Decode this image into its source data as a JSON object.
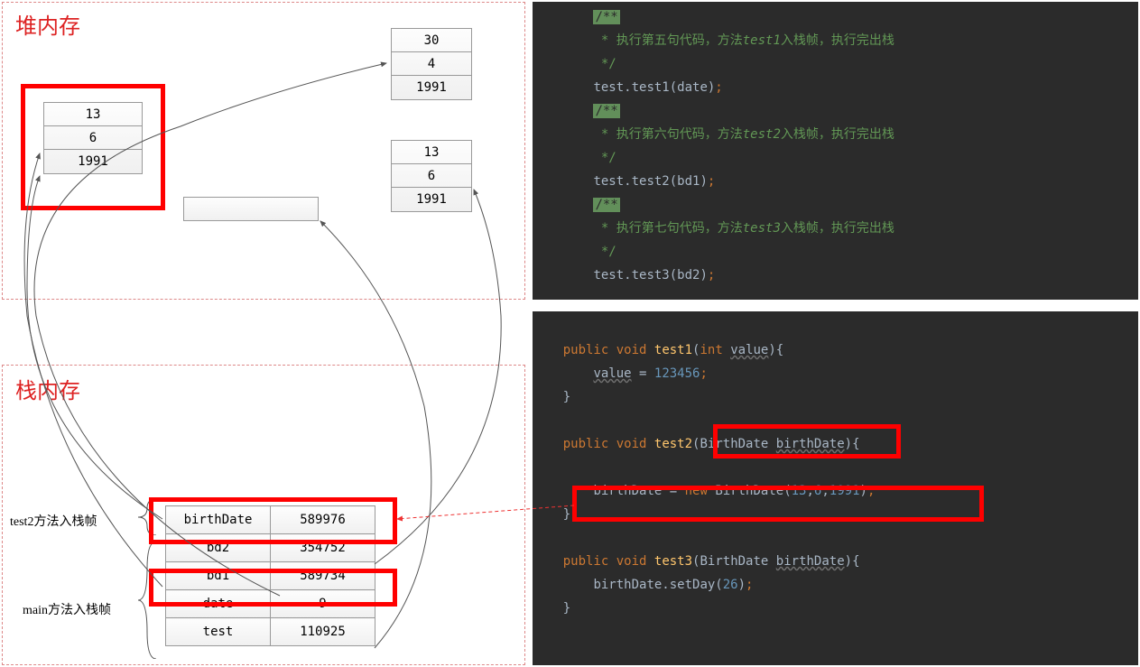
{
  "heap": {
    "title": "堆内存",
    "block1": {
      "r1": "30",
      "r2": "4",
      "r3": "1991"
    },
    "block2": {
      "r1": "13",
      "r2": "6",
      "r3": "1991"
    },
    "block3": {
      "r1": "13",
      "r2": "6",
      "r3": "1991"
    },
    "block4": ""
  },
  "stack": {
    "title": "栈内存",
    "label_test2": "test2方法入栈帧",
    "label_main": "main方法入栈帧",
    "rows": [
      {
        "name": "birthDate",
        "val": "589976"
      },
      {
        "name": "bd2",
        "val": "354752"
      },
      {
        "name": "bd1",
        "val": "589734"
      },
      {
        "name": "date",
        "val": "9"
      },
      {
        "name": "test",
        "val": "110925"
      }
    ]
  },
  "code_top": {
    "l1": " * 执行第五句代码，方法",
    "l1b": "入栈帧，执行完出栈",
    "m1": "test1",
    "stmt1": "test.test1(date)",
    "l2": " * 执行第六句代码，方法",
    "l2b": "入栈帧，执行完出栈",
    "m2": "test2",
    "stmt2": "test.test2(bd1)",
    "l3": " * 执行第七句代码，方法",
    "l3b": "入栈帧，执行完出栈",
    "m3": "test3",
    "stmt3": "test.test3(bd2)",
    "comment_close": " */",
    "tag": "/**"
  },
  "code_bottom": {
    "public": "public",
    "void": "void",
    "int": "int",
    "new": "new",
    "t1_name": "test1",
    "t1_param": "value",
    "t1_body_lhs": "value",
    "t1_body_val": "123456",
    "t2_name": "test2",
    "t2_type": "BirthDate",
    "t2_param": "birthDate",
    "t2_body_lhs": "birthDate",
    "t2_body_call": "BirthDate",
    "t2_args_a": "13",
    "t2_args_b": "6",
    "t2_args_c": "1991",
    "t3_name": "test3",
    "t3_type": "BirthDate",
    "t3_param": "birthDate",
    "t3_body": "birthDate.setDay(",
    "t3_arg": "26",
    "t3_body_end": ")"
  }
}
